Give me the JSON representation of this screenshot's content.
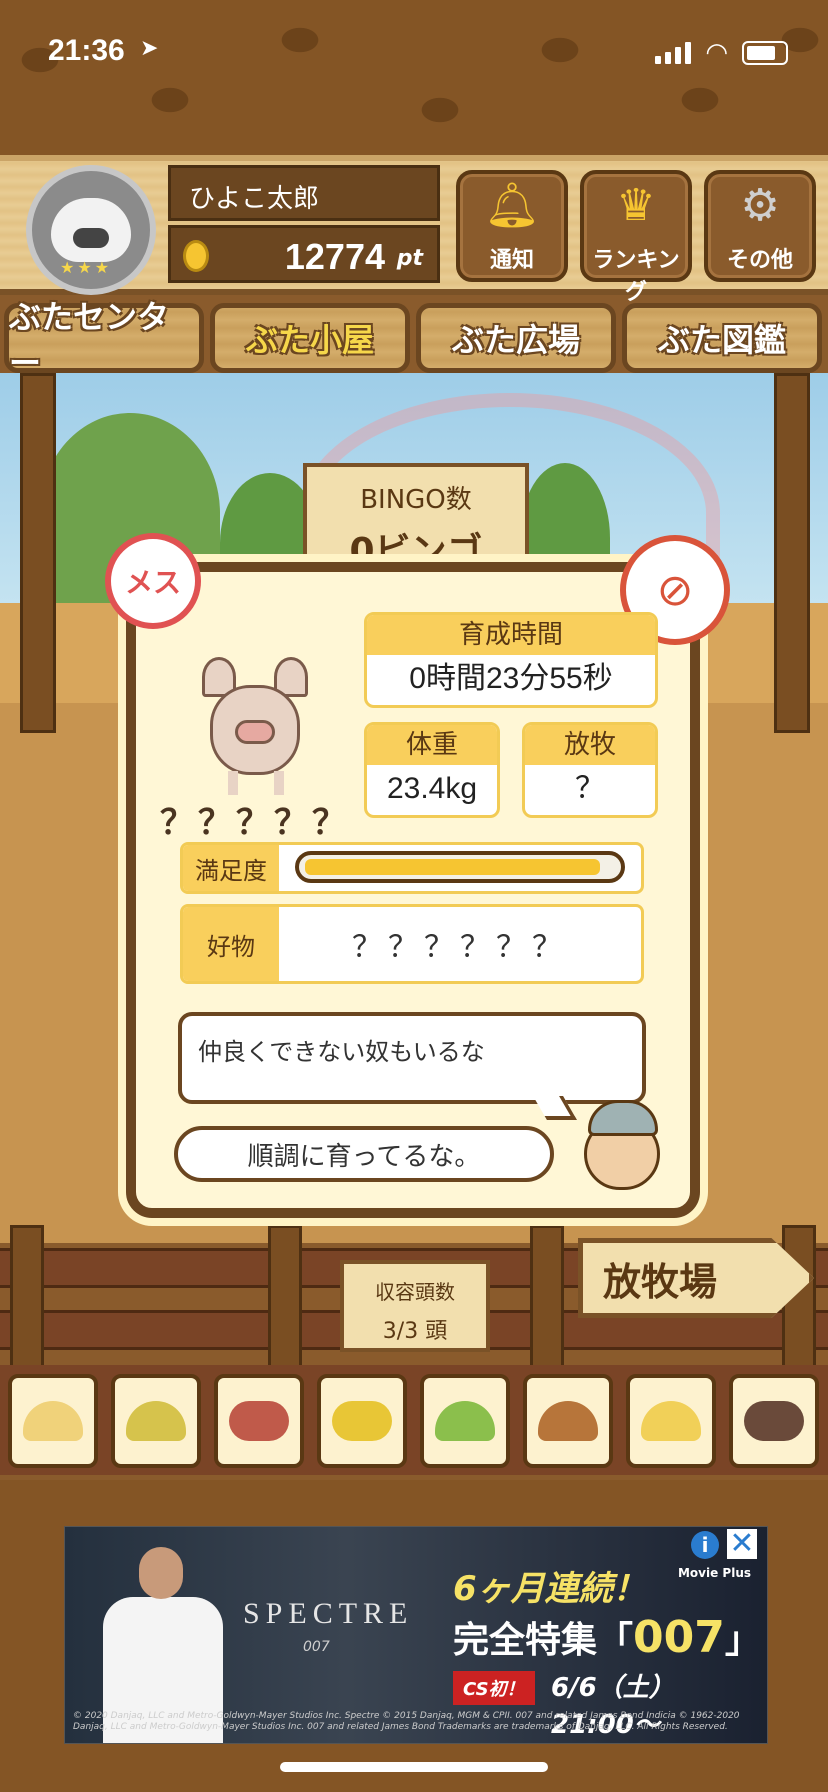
{
  "status_bar": {
    "time": "21:36",
    "location_icon": "location-arrow-icon"
  },
  "header": {
    "player_name": "ひよこ太郎",
    "points": "12774",
    "points_unit": "pt",
    "buttons": [
      {
        "label": "通知",
        "icon": "bell-icon"
      },
      {
        "label": "ランキング",
        "icon": "crown-icon"
      },
      {
        "label": "その他",
        "icon": "gear-icon"
      }
    ]
  },
  "tabs": [
    {
      "label": "ぶたセンター",
      "active": false
    },
    {
      "label": "ぶた小屋",
      "active": true
    },
    {
      "label": "ぶた広場",
      "active": false
    },
    {
      "label": "ぶた図鑑",
      "active": false
    }
  ],
  "bingo": {
    "title": "BINGO数",
    "value": "0ビンゴ"
  },
  "pig_card": {
    "gender_label": "メス",
    "name": "？？？？？",
    "growth_time": {
      "label": "育成時間",
      "value": "0時間23分55秒"
    },
    "weight": {
      "label": "体重",
      "value": "23.4kg"
    },
    "grazing": {
      "label": "放牧",
      "value": "？"
    },
    "satisfaction": {
      "label": "満足度",
      "level": 0.95
    },
    "favorite": {
      "label": "好物",
      "value": "？？？？？？"
    },
    "message_1": "仲良くできない奴もいるな",
    "message_2": "順調に育ってるな。"
  },
  "capacity": {
    "label": "収容頭数",
    "value": "3/3 頭"
  },
  "pasture_sign": "放牧場",
  "food_items": [
    "feed-1",
    "feed-2",
    "sweet-potato",
    "corn",
    "herb-berry",
    "acorn",
    "feed-bowl",
    "meatball-plate"
  ],
  "ad": {
    "movie_title": "SPECTRE",
    "movie_sub": "007",
    "headline": "6ヶ月連続！",
    "line2_prefix": "完全特集「",
    "line2_highlight": "007",
    "line2_suffix": "」",
    "badge": "CS初！",
    "date": "6/6（土）21:00〜",
    "channel": "Movie Plus",
    "credit": "© 2020 Danjaq, LLC and Metro-Goldwyn-Mayer Studios Inc. Spectre © 2015 Danjaq, MGM & CPII. 007 and related James Bond Indicia © 1962-2020 Danjaq, LLC and Metro-Goldwyn-Mayer Studios Inc. 007 and related James Bond Trademarks are trademarks of Danjaq, LLC. All Rights Reserved."
  },
  "colors": {
    "accent": "#f9cf5c",
    "wood_dark": "#6b4620",
    "gender": "#e05252"
  }
}
